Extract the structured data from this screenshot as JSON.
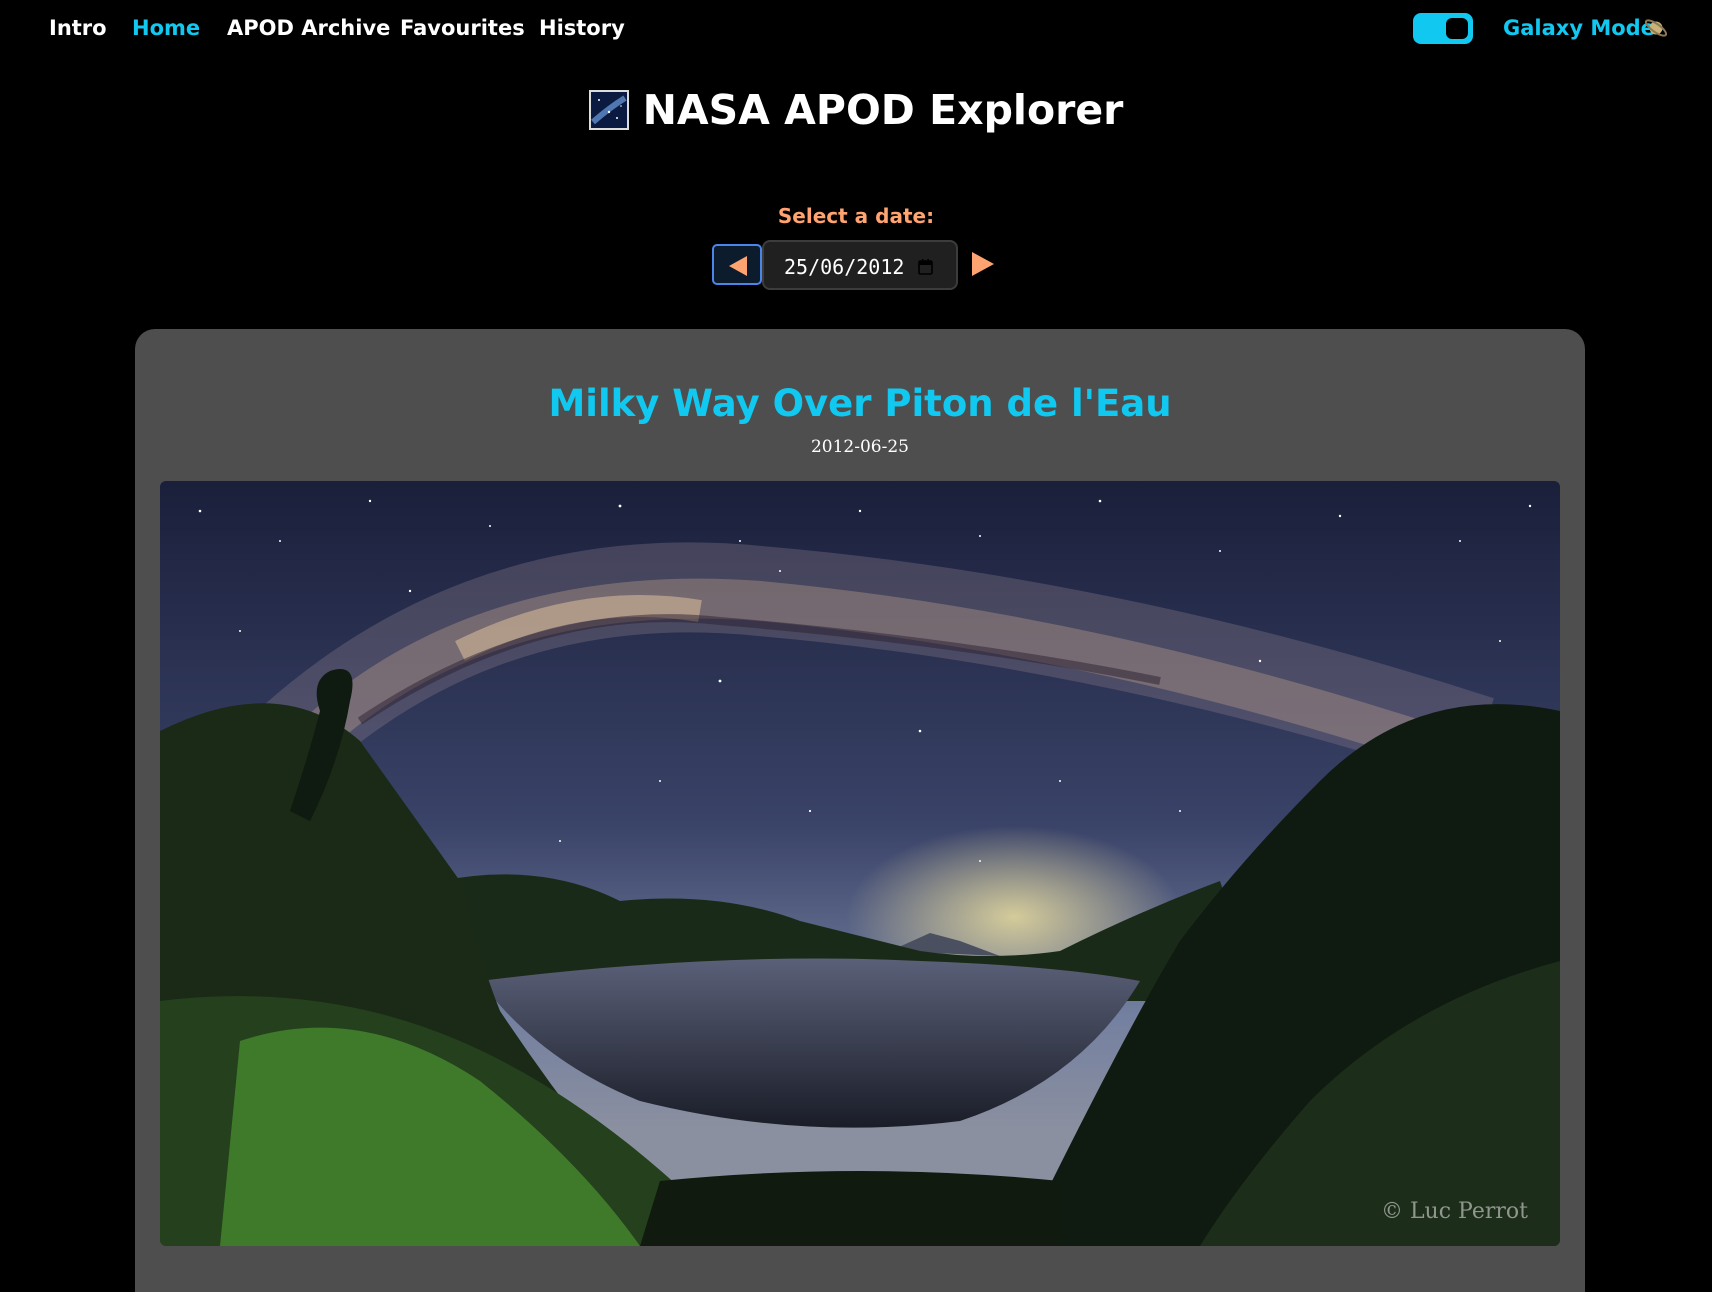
{
  "nav": {
    "items": [
      {
        "label": "Intro"
      },
      {
        "label": "Home"
      },
      {
        "label": "APOD Archive"
      },
      {
        "label": "Favourites"
      },
      {
        "label": "History"
      }
    ],
    "galaxy_mode_label": "Galaxy Mode",
    "galaxy_mode_on": true,
    "galaxy_icon": "saturn-icon"
  },
  "header": {
    "title": "NASA APOD Explorer",
    "logo_icon": "milky-way-icon"
  },
  "date_picker": {
    "label": "Select a date:",
    "value": "25/06/2012",
    "prev_icon": "triangle-left-icon",
    "next_icon": "triangle-right-icon"
  },
  "apod": {
    "title": "Milky Way Over Piton de l'Eau",
    "date": "2012-06-25",
    "image_credit": "© Luc Perrot"
  },
  "colors": {
    "accent": "#10c8f0",
    "orange": "#ffa470",
    "card_bg": "#4e4e4e",
    "page_bg": "#000000"
  }
}
